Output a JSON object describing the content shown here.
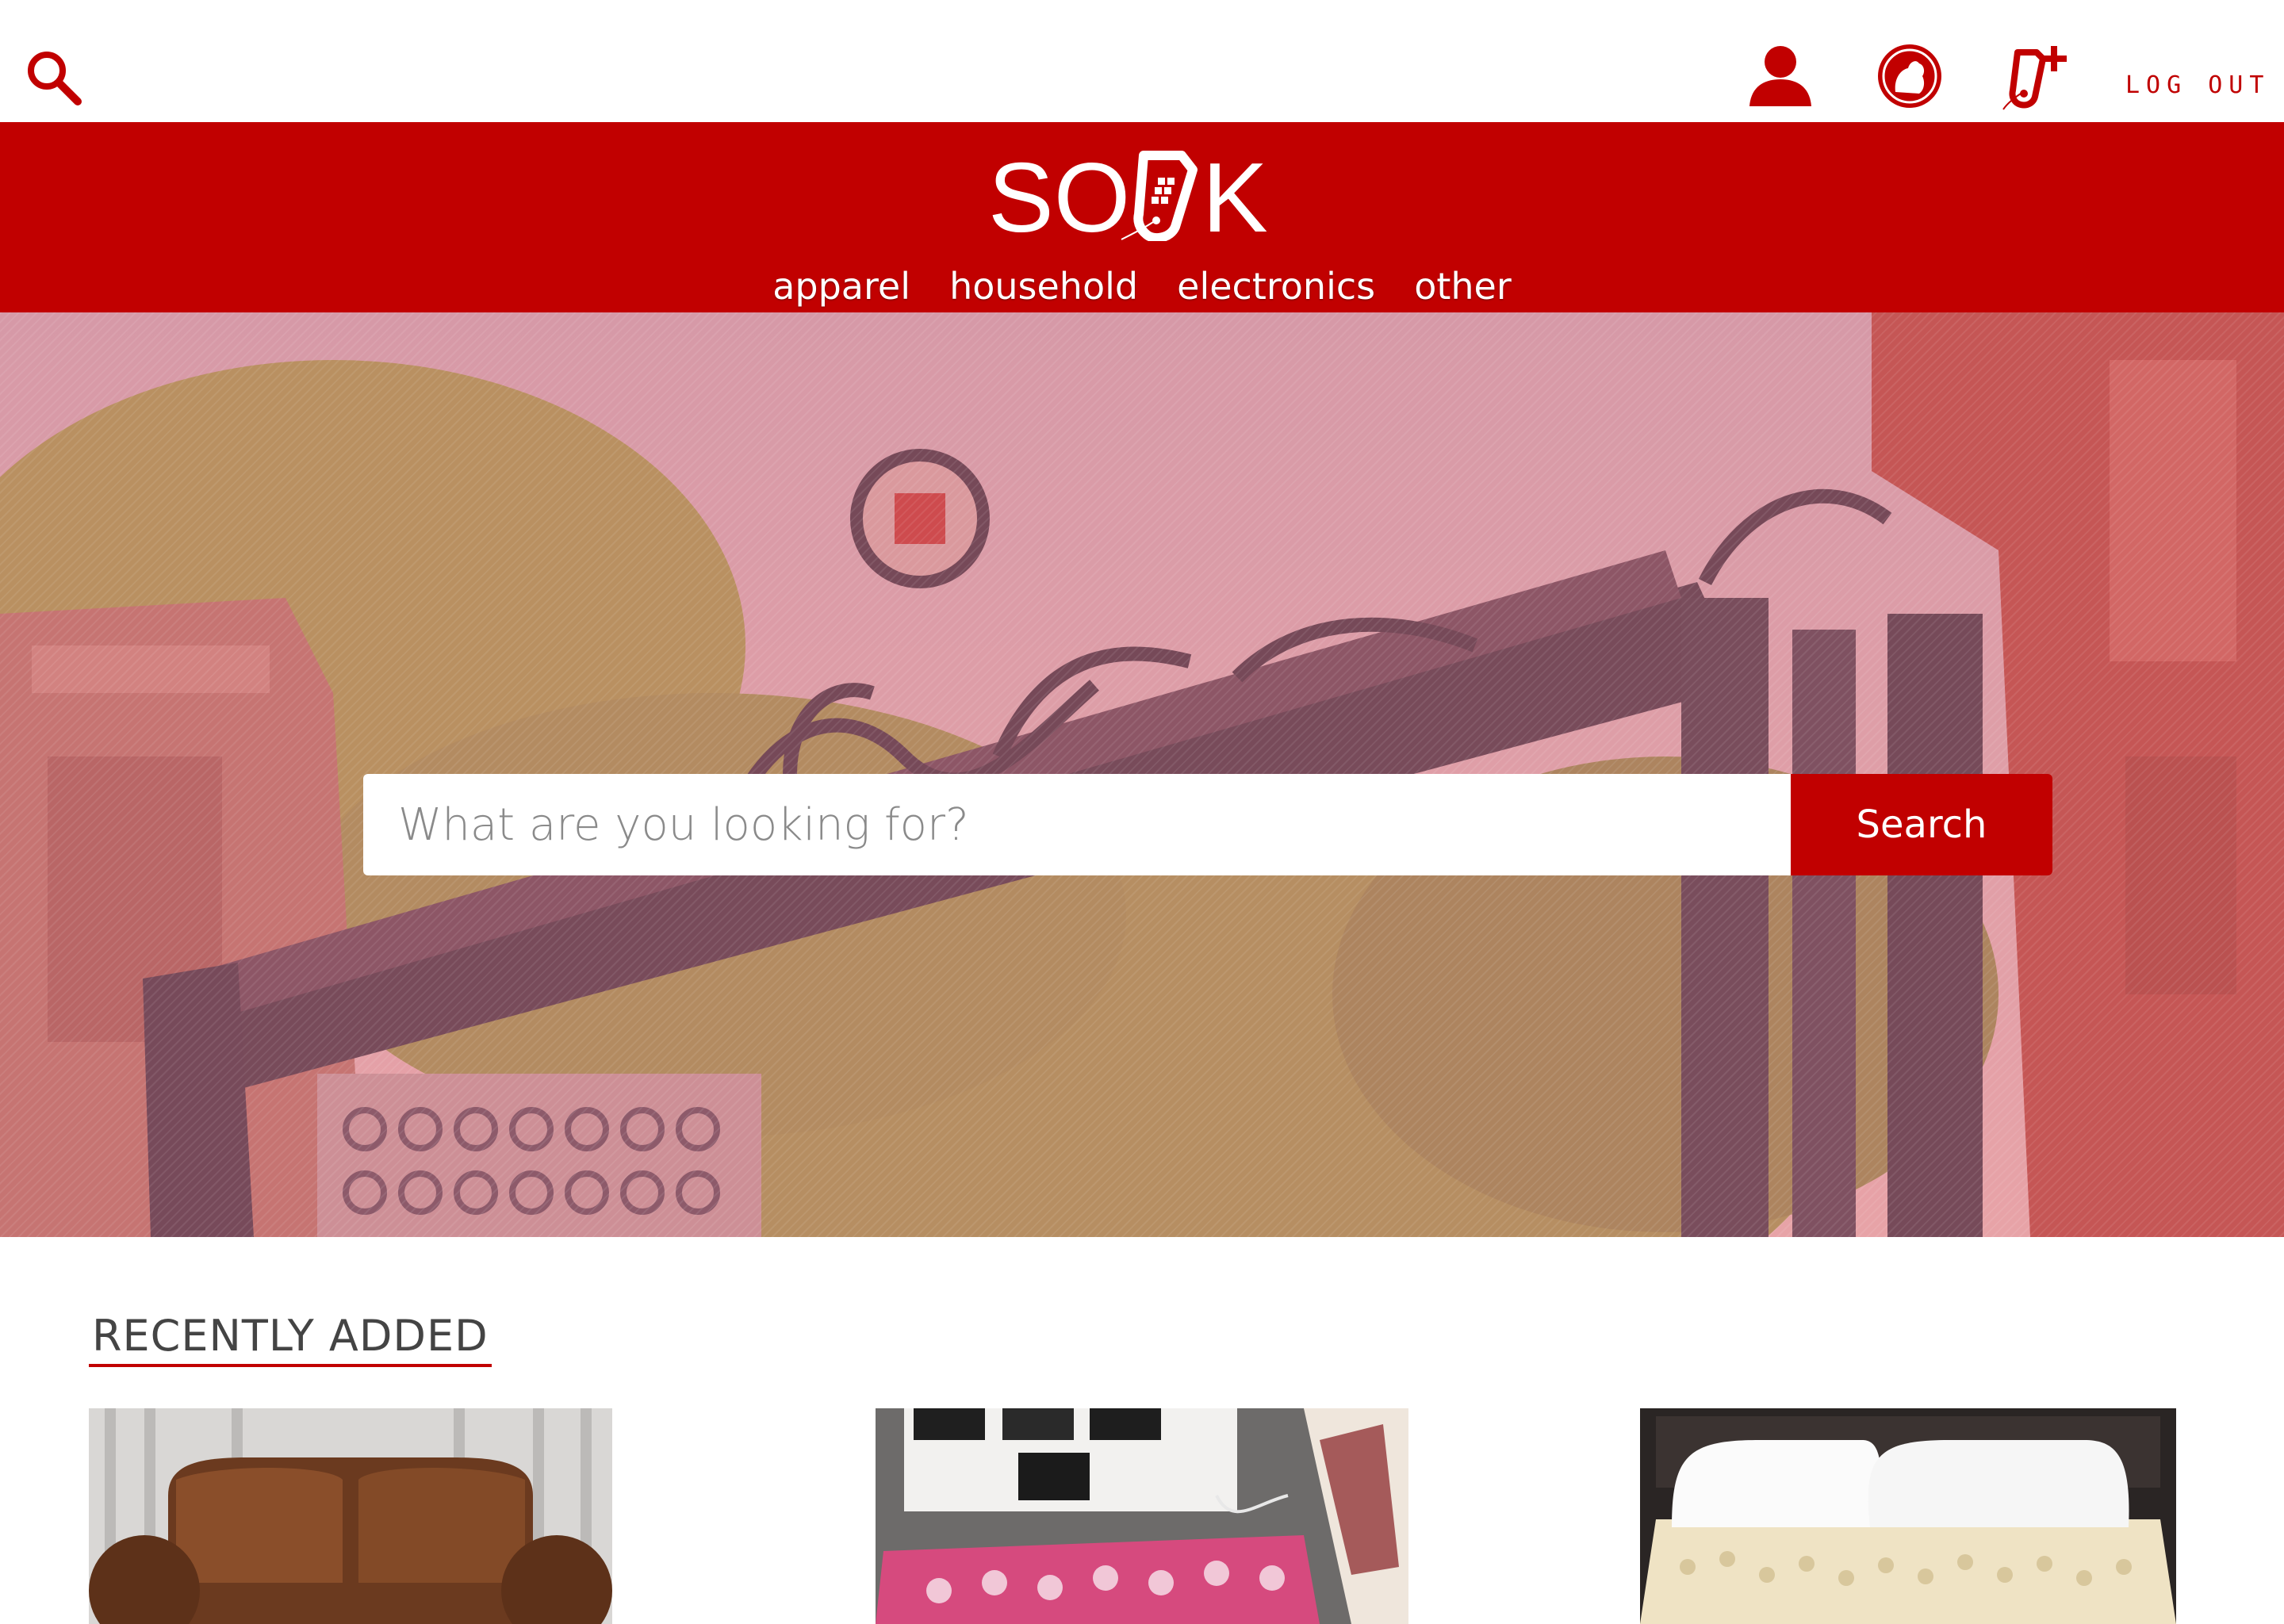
{
  "app": {
    "brand_name": "SOUK",
    "brand_color": "#c10000"
  },
  "topbar": {
    "icons": [
      "search-icon",
      "user-icon",
      "bear-mascot-icon",
      "add-listing-tag-icon"
    ],
    "logout_label": "LOG OUT"
  },
  "nav": {
    "categories": [
      {
        "label": "apparel"
      },
      {
        "label": "household"
      },
      {
        "label": "electronics"
      },
      {
        "label": "other"
      }
    ]
  },
  "hero": {
    "search_placeholder": "What are you looking for?",
    "search_button_label": "Search"
  },
  "recent": {
    "title": "RECENTLY ADDED",
    "products": [
      {
        "image": "brown-leather-loveseat"
      },
      {
        "image": "pink-patterned-rug"
      },
      {
        "image": "mattress-topper-with-pillows"
      }
    ]
  }
}
